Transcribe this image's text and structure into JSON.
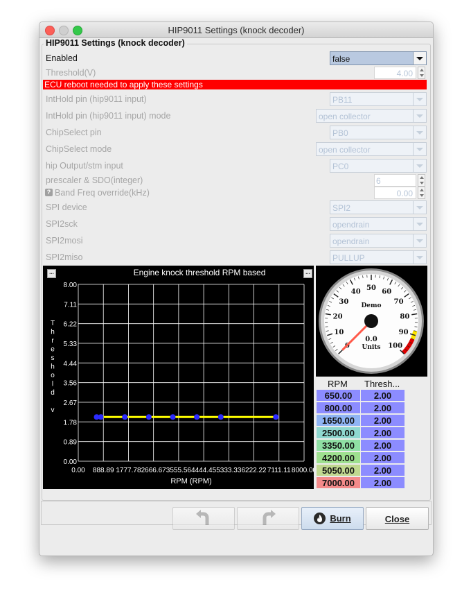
{
  "window": {
    "title": "HIP9011 Settings (knock decoder)"
  },
  "panel": {
    "title": "HIP9011 Settings (knock decoder)"
  },
  "fields": {
    "enabled": {
      "label": "Enabled",
      "value": "false"
    },
    "threshold": {
      "label": "Threshold(V)",
      "value": "4.00"
    },
    "reboot_notice": "ECU reboot needed to apply these settings",
    "inthold_pin": {
      "label": "IntHold pin (hip9011 input)",
      "value": "PB11"
    },
    "inthold_mode": {
      "label": "IntHold pin (hip9011 input) mode",
      "value": "open collector"
    },
    "chipselect_pin": {
      "label": "ChipSelect pin",
      "value": "PB0"
    },
    "chipselect_mode": {
      "label": "ChipSelect mode",
      "value": "open collector"
    },
    "hip_output": {
      "label": "hip Output/stm input",
      "value": "PC0"
    },
    "prescaler": {
      "label": "prescaler & SDO(integer)",
      "value": "6"
    },
    "band_freq": {
      "label": "Band Freq override(kHz)",
      "value": "0.00",
      "help_icon": "?"
    },
    "spi_device": {
      "label": "SPI device",
      "value": "SPI2"
    },
    "spi2sck": {
      "label": "SPI2sck",
      "value": "opendrain"
    },
    "spi2mosi": {
      "label": "SPI2mosi",
      "value": "opendrain"
    },
    "spi2miso": {
      "label": "SPI2miso",
      "value": "PULLUP"
    }
  },
  "chart": {
    "button_label": "...",
    "y_axis_letters": [
      "T",
      "h",
      "r",
      "e",
      "s",
      "h",
      "o",
      "l",
      "d",
      "",
      "v"
    ],
    "colors": {
      "background": "#000000",
      "grid": "#ffffff",
      "line": "#ffff00",
      "point": "#2b2bff"
    }
  },
  "chart_data": {
    "type": "line",
    "title": "Engine knock threshold RPM based",
    "xlabel": "RPM (RPM)",
    "ylabel": "Threshold v",
    "xlim": [
      0,
      8000
    ],
    "ylim": [
      0,
      8
    ],
    "x_ticks": [
      "0.00",
      "888.89",
      "1777.78",
      "2666.67",
      "3555.56",
      "4444.45",
      "5333.33",
      "6222.22",
      "7111.11",
      "8000.00"
    ],
    "y_ticks": [
      "0.00",
      "0.89",
      "1.78",
      "2.67",
      "3.56",
      "4.44",
      "5.33",
      "6.22",
      "7.11",
      "8.00"
    ],
    "grid": true,
    "series": [
      {
        "x": [
          650,
          800,
          1650,
          2500,
          3350,
          4200,
          5050,
          7000
        ],
        "y": [
          2,
          2,
          2,
          2,
          2,
          2,
          2,
          2
        ]
      }
    ]
  },
  "gauge": {
    "label": "Demo",
    "value": "0.0",
    "units": "Units",
    "ticks": [
      "0",
      "10",
      "20",
      "30",
      "40",
      "50",
      "60",
      "70",
      "80",
      "90",
      "100"
    ],
    "reading": 0
  },
  "table": {
    "headers": [
      "RPM",
      "Thresh..."
    ],
    "rows": [
      {
        "rpm": "650.00",
        "thresh": "2.00",
        "color": "#8c8cff"
      },
      {
        "rpm": "800.00",
        "thresh": "2.00",
        "color": "#8c8cff"
      },
      {
        "rpm": "1650.00",
        "thresh": "2.00",
        "color": "#8fb4f4"
      },
      {
        "rpm": "2500.00",
        "thresh": "2.00",
        "color": "#8fd8d0"
      },
      {
        "rpm": "3350.00",
        "thresh": "2.00",
        "color": "#8fe0a4"
      },
      {
        "rpm": "4200.00",
        "thresh": "2.00",
        "color": "#9ee08f"
      },
      {
        "rpm": "5050.00",
        "thresh": "2.00",
        "color": "#c0d890"
      },
      {
        "rpm": "7000.00",
        "thresh": "2.00",
        "color": "#f48a8a"
      }
    ],
    "thresh_color": "#8c8cff"
  },
  "buttons": {
    "undo": "undo-icon",
    "redo": "redo-icon",
    "burn": "Burn",
    "close": "Close"
  }
}
